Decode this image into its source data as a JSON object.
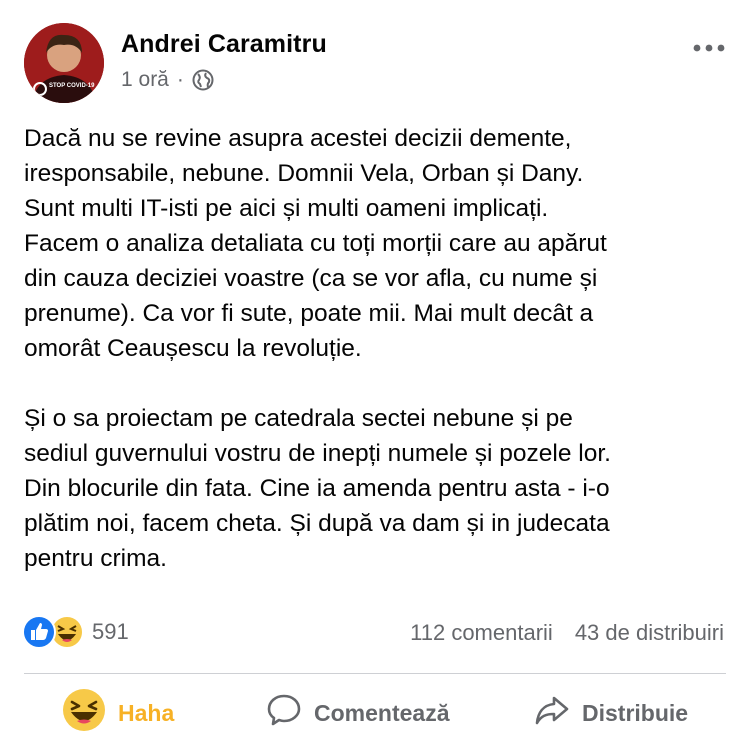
{
  "post": {
    "author": "Andrei Caramitru",
    "time": "1 oră",
    "separator": "·",
    "avatar_badge": "STOP COVID-19",
    "paragraphs": [
      "Dacă nu se revine asupra acestei decizii demente,\niresponsabile, nebune. Domnii Vela, Orban și Dany.\nSunt multi IT-isti pe aici și multi oameni implicați.\nFacem o analiza detaliata cu toți morții care au apărut\ndin cauza deciziei voastre (ca se vor afla, cu nume și\nprenume). Ca vor fi sute, poate mii. Mai mult decât a\nomorât Ceaușescu la revoluție.",
      "Și o sa proiectam pe catedrala sectei nebune și pe\nsediul guvernului vostru de inepți numele și pozele lor.\nDin blocurile din fata. Cine ia amenda pentru asta - i-o\nplătim noi, facem cheta. Și după va dam și in judecata\npentru crima."
    ]
  },
  "stats": {
    "reaction_count": "591",
    "comments": "112 comentarii",
    "shares": "43 de distribuiri"
  },
  "actions": {
    "haha": "Haha",
    "comment": "Comentează",
    "share": "Distribuie"
  },
  "colors": {
    "haha_active": "#f7b125",
    "secondary_text": "#65676b",
    "like_blue": "#1877f2"
  },
  "icons": [
    "globe-icon",
    "more-icon",
    "like-reaction-icon",
    "haha-reaction-icon",
    "comment-icon",
    "share-icon"
  ]
}
